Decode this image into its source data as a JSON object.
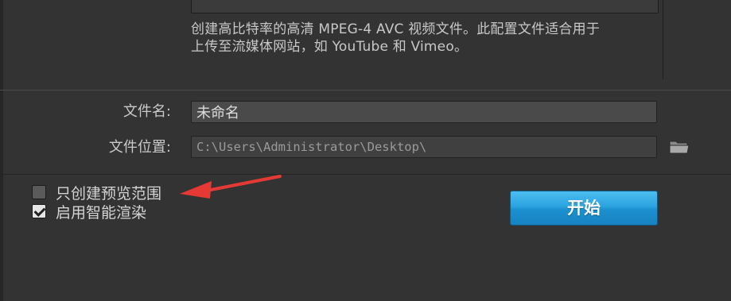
{
  "description": {
    "line1": "创建高比特率的高清 MPEG-4 AVC 视频文件。此配置文件适合用于",
    "line2": "上传至流媒体网站，如 YouTube 和 Vimeo。"
  },
  "form": {
    "filename_label": "文件名:",
    "filename_value": "未命名",
    "location_label": "文件位置:",
    "location_value": "C:\\Users\\Administrator\\Desktop\\"
  },
  "options": {
    "preview_range_label": "只创建预览范围",
    "preview_range_checked": false,
    "smart_render_label": "启用智能渲染",
    "smart_render_checked": true
  },
  "actions": {
    "start_label": "开始"
  },
  "colors": {
    "background": "#333333",
    "accent": "#2ba3e0",
    "annotation_arrow": "#e53935"
  }
}
